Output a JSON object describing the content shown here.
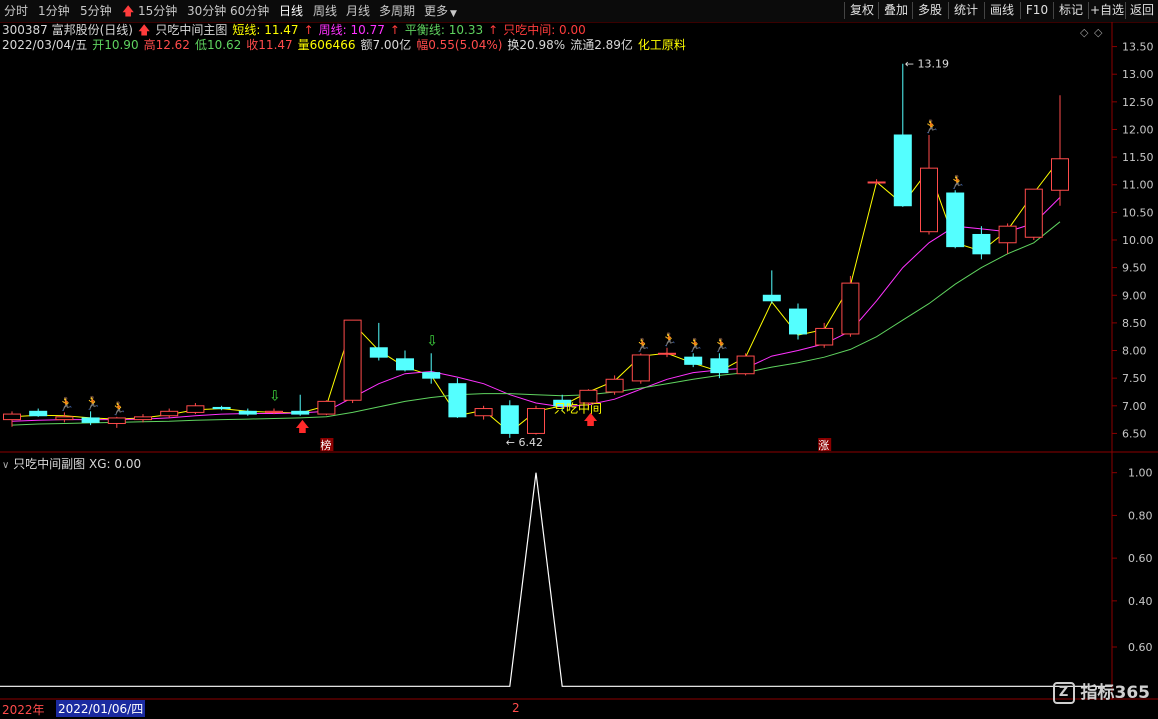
{
  "toolbar": {
    "periods": [
      "分时",
      "1分钟",
      "5分钟",
      "15分钟",
      "30分钟",
      "60分钟",
      "日线",
      "周线",
      "月线",
      "多周期",
      "更多"
    ],
    "active": "日线",
    "right_buttons": [
      "复权",
      "叠加",
      "多股",
      "统计",
      "画线",
      "F10",
      "标记",
      "+自选",
      "返回"
    ],
    "up_arrow_icon": "red-up-arrow-icon"
  },
  "info": {
    "stock": "300387 富邦股份(日线)",
    "indicator_name": "只吃中间主图",
    "short_line": "短线: 11.47",
    "weekly_line": "周线: 10.77",
    "balance_line": "平衡线: 10.33",
    "middle_line": "只吃中间: 0.00",
    "date": "2022/03/04/五",
    "open": "开10.90",
    "high": "高12.62",
    "low": "低10.62",
    "close": "收11.47",
    "volume": "量606466",
    "amount": "额7.00亿",
    "change": "幅0.55(5.04%)",
    "turnover": "换20.98%",
    "float_cap": "流通2.89亿",
    "sector": "化工原料"
  },
  "subchart": {
    "label": "只吃中间副图",
    "value": "XG: 0.00"
  },
  "bottom": {
    "year": "2022年",
    "date": "2022/01/06/四",
    "marker": "2"
  },
  "watermark": "指标365",
  "colors": {
    "up": "#ff4b4b",
    "down": "#54ffff",
    "short_line": "#ffff00",
    "weekly_line": "#ff32ff",
    "balance_line": "#5fd35f",
    "axis": "#8b0000",
    "axis_text": "#c8c8c8"
  },
  "chart_data": [
    {
      "type": "candlestick",
      "title": "",
      "ylim": [
        6.2,
        13.8
      ],
      "y_ticks": [
        6.5,
        7.0,
        7.5,
        8.0,
        8.5,
        9.0,
        9.5,
        10.0,
        10.5,
        11.0,
        11.5,
        12.0,
        12.5,
        13.0,
        13.5
      ],
      "candles": [
        {
          "o": 6.75,
          "h": 6.9,
          "l": 6.62,
          "c": 6.85
        },
        {
          "o": 6.9,
          "h": 6.95,
          "l": 6.8,
          "c": 6.82
        },
        {
          "o": 6.75,
          "h": 6.88,
          "l": 6.7,
          "c": 6.8
        },
        {
          "o": 6.78,
          "h": 6.9,
          "l": 6.65,
          "c": 6.7
        },
        {
          "o": 6.68,
          "h": 6.8,
          "l": 6.6,
          "c": 6.78
        },
        {
          "o": 6.75,
          "h": 6.85,
          "l": 6.7,
          "c": 6.8
        },
        {
          "o": 6.82,
          "h": 6.95,
          "l": 6.78,
          "c": 6.9
        },
        {
          "o": 6.88,
          "h": 7.05,
          "l": 6.85,
          "c": 7.0
        },
        {
          "o": 6.97,
          "h": 7.0,
          "l": 6.92,
          "c": 6.95
        },
        {
          "o": 6.9,
          "h": 6.95,
          "l": 6.82,
          "c": 6.85
        },
        {
          "o": 6.88,
          "h": 6.95,
          "l": 6.85,
          "c": 6.9
        },
        {
          "o": 6.9,
          "h": 7.2,
          "l": 6.82,
          "c": 6.85
        },
        {
          "o": 6.85,
          "h": 7.1,
          "l": 6.83,
          "c": 7.08
        },
        {
          "o": 7.1,
          "h": 8.55,
          "l": 7.05,
          "c": 8.55
        },
        {
          "o": 8.05,
          "h": 8.5,
          "l": 7.82,
          "c": 7.88
        },
        {
          "o": 7.85,
          "h": 8.0,
          "l": 7.62,
          "c": 7.65
        },
        {
          "o": 7.6,
          "h": 7.95,
          "l": 7.4,
          "c": 7.5
        },
        {
          "o": 7.4,
          "h": 7.5,
          "l": 6.78,
          "c": 6.8
        },
        {
          "o": 6.82,
          "h": 7.0,
          "l": 6.75,
          "c": 6.95
        },
        {
          "o": 7.0,
          "h": 7.1,
          "l": 6.42,
          "c": 6.5
        },
        {
          "o": 6.5,
          "h": 7.0,
          "l": 6.48,
          "c": 6.95
        },
        {
          "o": 7.1,
          "h": 7.2,
          "l": 6.9,
          "c": 7.0
        },
        {
          "o": 7.05,
          "h": 7.3,
          "l": 6.95,
          "c": 7.28
        },
        {
          "o": 7.25,
          "h": 7.55,
          "l": 7.2,
          "c": 7.48
        },
        {
          "o": 7.45,
          "h": 7.95,
          "l": 7.4,
          "c": 7.92
        },
        {
          "o": 7.95,
          "h": 8.05,
          "l": 7.88,
          "c": 7.95
        },
        {
          "o": 7.88,
          "h": 7.95,
          "l": 7.7,
          "c": 7.75
        },
        {
          "o": 7.85,
          "h": 7.95,
          "l": 7.5,
          "c": 7.6
        },
        {
          "o": 7.58,
          "h": 7.95,
          "l": 7.55,
          "c": 7.9
        },
        {
          "o": 9.0,
          "h": 9.45,
          "l": 8.85,
          "c": 8.9
        },
        {
          "o": 8.75,
          "h": 8.85,
          "l": 8.2,
          "c": 8.3
        },
        {
          "o": 8.1,
          "h": 8.5,
          "l": 8.05,
          "c": 8.4
        },
        {
          "o": 8.3,
          "h": 9.35,
          "l": 8.25,
          "c": 9.22
        },
        {
          "o": 11.05,
          "h": 11.1,
          "l": 11.0,
          "c": 11.05
        },
        {
          "o": 11.9,
          "h": 13.19,
          "l": 10.6,
          "c": 10.62
        },
        {
          "o": 10.15,
          "h": 11.9,
          "l": 10.1,
          "c": 11.3
        },
        {
          "o": 10.85,
          "h": 10.9,
          "l": 9.85,
          "c": 9.88
        },
        {
          "o": 10.1,
          "h": 10.25,
          "l": 9.65,
          "c": 9.75
        },
        {
          "o": 9.95,
          "h": 10.3,
          "l": 9.75,
          "c": 10.25
        },
        {
          "o": 10.05,
          "h": 10.7,
          "l": 10.0,
          "c": 10.92
        },
        {
          "o": 10.9,
          "h": 12.62,
          "l": 10.62,
          "c": 11.47
        }
      ],
      "series": [
        {
          "name": "短线",
          "values": [
            6.8,
            6.83,
            6.82,
            6.78,
            6.76,
            6.78,
            6.84,
            6.93,
            6.95,
            6.9,
            6.88,
            6.87,
            7.0,
            8.5,
            8.0,
            7.7,
            7.55,
            6.82,
            6.92,
            6.52,
            6.9,
            7.0,
            7.25,
            7.45,
            7.9,
            7.95,
            7.77,
            7.62,
            7.88,
            8.88,
            8.28,
            8.38,
            9.18,
            11.05,
            10.65,
            11.28,
            9.95,
            9.8,
            10.18,
            10.85,
            11.47
          ]
        },
        {
          "name": "周线",
          "values": [
            6.72,
            6.74,
            6.75,
            6.75,
            6.75,
            6.76,
            6.78,
            6.82,
            6.85,
            6.86,
            6.86,
            6.87,
            6.9,
            7.15,
            7.4,
            7.58,
            7.62,
            7.52,
            7.4,
            7.2,
            7.05,
            6.98,
            7.02,
            7.12,
            7.3,
            7.48,
            7.6,
            7.65,
            7.68,
            7.9,
            8.0,
            8.12,
            8.35,
            8.9,
            9.5,
            9.95,
            10.25,
            10.2,
            10.15,
            10.3,
            10.77
          ]
        },
        {
          "name": "平衡线",
          "values": [
            6.65,
            6.67,
            6.68,
            6.69,
            6.7,
            6.71,
            6.72,
            6.74,
            6.75,
            6.76,
            6.77,
            6.78,
            6.8,
            6.88,
            6.98,
            7.08,
            7.15,
            7.2,
            7.22,
            7.22,
            7.2,
            7.18,
            7.2,
            7.25,
            7.32,
            7.4,
            7.48,
            7.55,
            7.6,
            7.7,
            7.78,
            7.88,
            8.02,
            8.25,
            8.55,
            8.85,
            9.2,
            9.5,
            9.75,
            9.95,
            10.33
          ]
        }
      ],
      "annotations": {
        "max_label": "13.19",
        "min_label": "6.42",
        "signal_text": "只吃中间",
        "badge_bang": "榜",
        "badge_zhang": "涨",
        "runner_icon_bars": [
          2,
          3,
          4,
          24,
          25,
          26,
          27,
          35,
          36
        ],
        "down_arrow_bars": [
          10,
          16
        ],
        "up_arrow_bars": [
          11,
          22
        ],
        "signal_text_bar": 20
      }
    },
    {
      "type": "line",
      "title": "只吃中间副图",
      "ylim": [
        -0.05,
        1.05
      ],
      "y_ticks": [
        1.0,
        0.8,
        0.6,
        0.4,
        0.6
      ],
      "series": [
        {
          "name": "XG",
          "values": [
            0,
            0,
            0,
            0,
            0,
            0,
            0,
            0,
            0,
            0,
            0,
            0,
            0,
            0,
            0,
            0,
            0,
            0,
            0,
            0,
            1,
            0,
            0,
            0,
            0,
            0,
            0,
            0,
            0,
            0,
            0,
            0,
            0,
            0,
            0,
            0,
            0,
            0,
            0,
            0,
            0
          ]
        }
      ]
    }
  ]
}
